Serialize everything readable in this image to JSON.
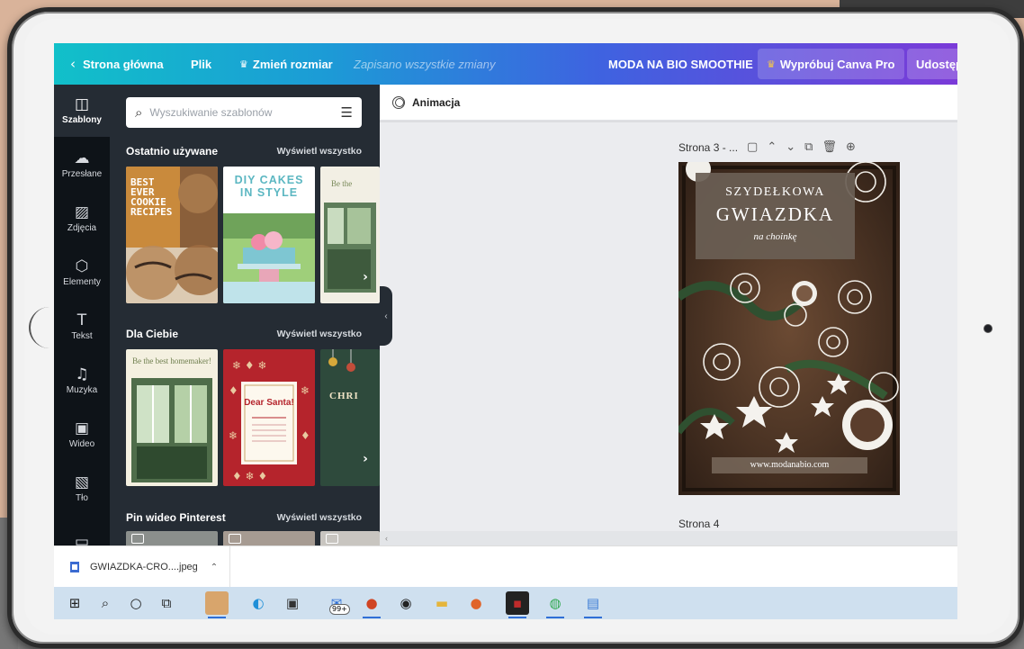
{
  "topbar": {
    "home_label": "Strona główna",
    "file_label": "Plik",
    "resize_label": "Zmień rozmiar",
    "saved_status": "Zapisano wszystkie zmiany",
    "project_title": "MODA NA BIO SMOOTHIE",
    "try_pro_label": "Wypróbuj Canva Pro",
    "share_label": "Udostęp"
  },
  "rail": {
    "items": [
      {
        "label": "Szablony",
        "icon": "templates-icon"
      },
      {
        "label": "Przesłane",
        "icon": "upload-cloud-icon"
      },
      {
        "label": "Zdjęcia",
        "icon": "photos-icon"
      },
      {
        "label": "Elementy",
        "icon": "elements-icon"
      },
      {
        "label": "Tekst",
        "icon": "text-icon"
      },
      {
        "label": "Muzyka",
        "icon": "music-icon"
      },
      {
        "label": "Wideo",
        "icon": "video-icon"
      },
      {
        "label": "Tło",
        "icon": "background-icon"
      },
      {
        "label": "",
        "icon": "folder-icon"
      }
    ]
  },
  "panel": {
    "search_placeholder": "Wyszukiwanie szablonów",
    "sections": [
      {
        "title": "Ostatnio używane",
        "link": "Wyświetl wszystko"
      },
      {
        "title": "Dla Ciebie",
        "link": "Wyświetl wszystko"
      },
      {
        "title": "Pin wideo Pinterest",
        "link": "Wyświetl wszystko"
      }
    ],
    "thumb_texts": {
      "cookie": "BEST EVER COOKIE RECIPES",
      "cakes": "DIY CAKES IN STYLE",
      "homemaker_small": "Be the",
      "homemaker": "Be the best homemaker!",
      "santa": "Dear Santa!",
      "chri": "CHRI"
    }
  },
  "editor": {
    "animation_label": "Animacja",
    "page3_label": "Strona 3 - ...",
    "page4_label": "Strona 4"
  },
  "design": {
    "line1": "SZYDEŁKOWA",
    "line2": "GWIAZDKA",
    "line3": "na choinkę",
    "url": "www.modanabio.com"
  },
  "downloads": {
    "file_name": "GWIAZDKA-CRO....jpeg"
  },
  "taskbar": {
    "badge": "99+"
  },
  "colors": {
    "topbar_start": "#11c0c9",
    "topbar_end": "#7a3ad8",
    "sidebar_bg": "#0e1318",
    "panel_bg": "#252c34",
    "crown": "#f7c948"
  }
}
